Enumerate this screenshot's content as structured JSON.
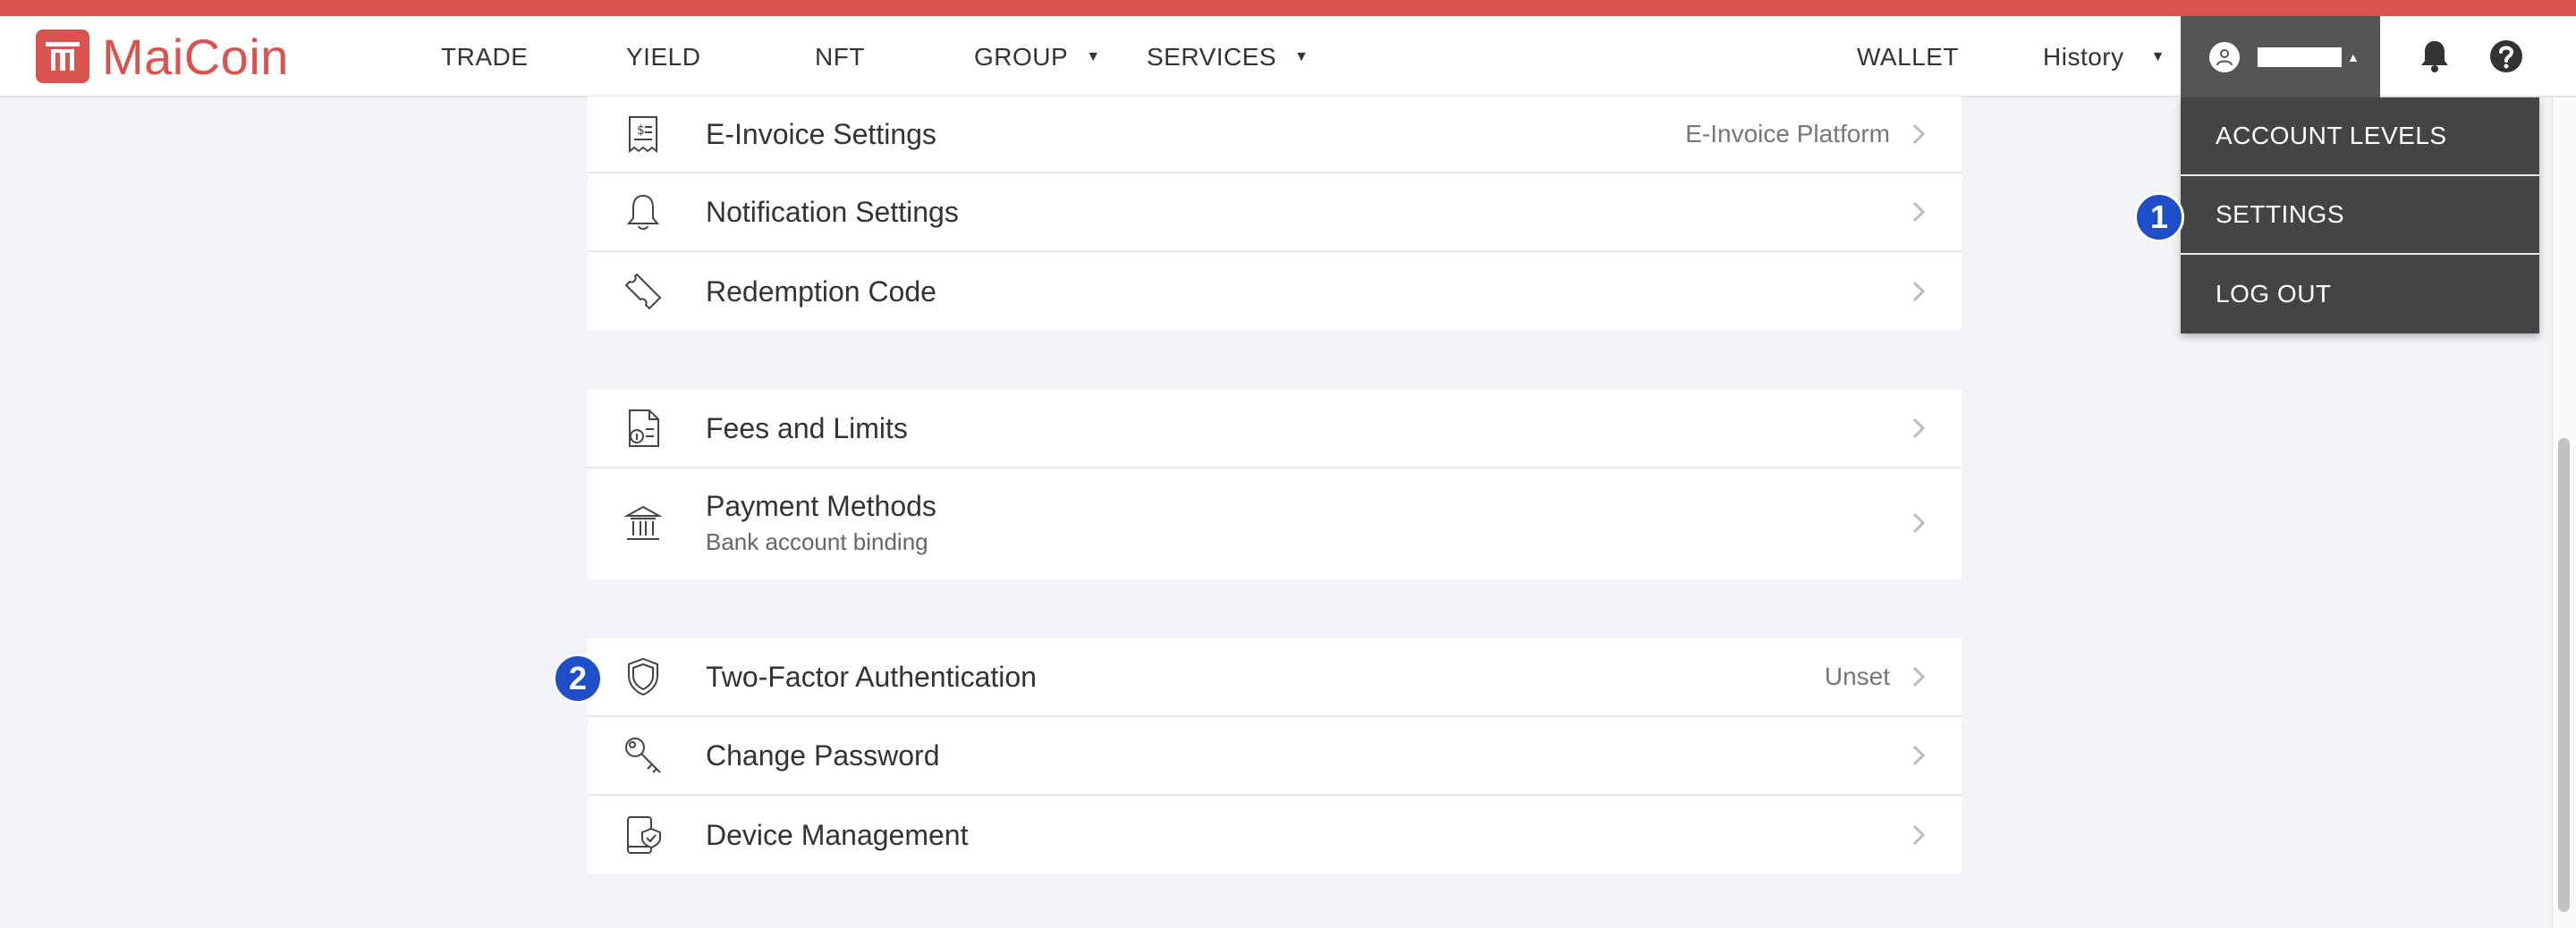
{
  "brand": {
    "name": "MaiCoin"
  },
  "nav": {
    "trade": "TRADE",
    "yield": "YIELD",
    "nft": "NFT",
    "group": "GROUP",
    "services": "SERVICES",
    "wallet": "WALLET",
    "history": "History"
  },
  "user_menu": {
    "items": [
      "ACCOUNT LEVELS",
      "SETTINGS",
      "LOG OUT"
    ]
  },
  "settings": {
    "group1": [
      {
        "label": "E-Invoice Settings",
        "value": "E-Invoice Platform",
        "icon": "invoice-icon"
      },
      {
        "label": "Notification Settings",
        "value": "",
        "icon": "bell-outline-icon"
      },
      {
        "label": "Redemption Code",
        "value": "",
        "icon": "ticket-icon"
      }
    ],
    "group2": [
      {
        "label": "Fees and Limits",
        "value": "",
        "icon": "fees-document-icon"
      },
      {
        "label": "Payment Methods",
        "sub": "Bank account binding",
        "icon": "bank-icon"
      }
    ],
    "group3": [
      {
        "label": "Two-Factor Authentication",
        "value": "Unset",
        "icon": "shield-icon"
      },
      {
        "label": "Change Password",
        "value": "",
        "icon": "key-icon"
      },
      {
        "label": "Device Management",
        "value": "",
        "icon": "device-shield-icon"
      }
    ]
  },
  "badges": {
    "one": "1",
    "two": "2"
  },
  "colors": {
    "brand": "#d9534f",
    "badge": "#1e4fc9",
    "menu_bg": "#444444"
  }
}
